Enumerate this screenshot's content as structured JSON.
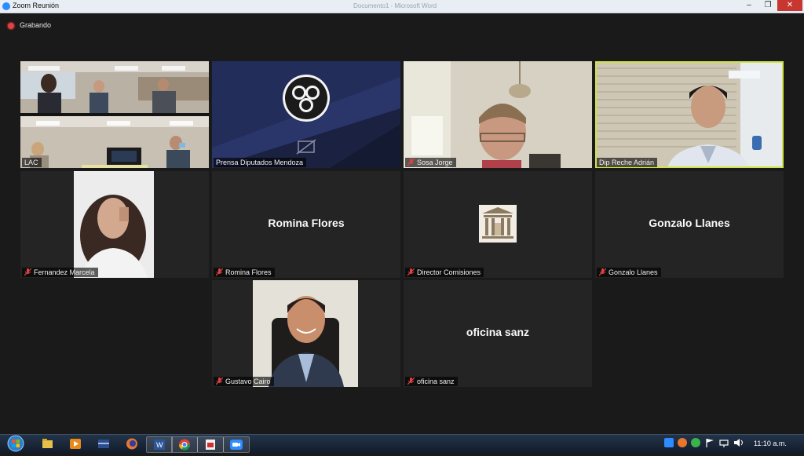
{
  "window": {
    "title": "Zoom Reunión",
    "background_title": "Documento1 - Microsoft Word",
    "controls": {
      "minimize": "–",
      "maximize": "❐",
      "close": "✕"
    }
  },
  "recording": {
    "label": "Grabando"
  },
  "participants": [
    {
      "id": "lac",
      "name": "LAC",
      "type": "video",
      "muted": false
    },
    {
      "id": "prensa",
      "name": "Prensa Diputados Mendoza",
      "type": "logo",
      "muted": false
    },
    {
      "id": "sosa",
      "name": "Sosa Jorge",
      "type": "video",
      "muted": true
    },
    {
      "id": "reche",
      "name": "Dip Reche Adrián",
      "type": "video",
      "muted": false,
      "active_speaker": true
    },
    {
      "id": "fernandez",
      "name": "Fernandez Marcela",
      "type": "video",
      "muted": true
    },
    {
      "id": "romina",
      "name": "Romina Flores",
      "display_text": "Romina Flores",
      "type": "name-only",
      "muted": true
    },
    {
      "id": "director",
      "name": "Director Comisiones",
      "type": "picture",
      "muted": true
    },
    {
      "id": "gonzalo",
      "name": "Gonzalo Llanes",
      "display_text": "Gonzalo Llanes",
      "type": "name-only",
      "muted": true
    },
    {
      "id": "gustavo",
      "name": "Gustavo Cairo",
      "type": "video",
      "muted": true
    },
    {
      "id": "oficina",
      "name": "oficina sanz",
      "display_text": "oficina sanz",
      "type": "name-only",
      "muted": true
    }
  ],
  "taskbar": {
    "clock": "11:10 a.m.",
    "apps": [
      "windows-explorer-icon",
      "media-player-icon",
      "app-icon",
      "firefox-icon",
      "word-icon",
      "chrome-icon",
      "pdf-icon",
      "zoom-icon"
    ]
  },
  "colors": {
    "active_speaker_border": "#cfe34b",
    "muted_mic": "#e04343",
    "background": "#1a1a1a"
  }
}
